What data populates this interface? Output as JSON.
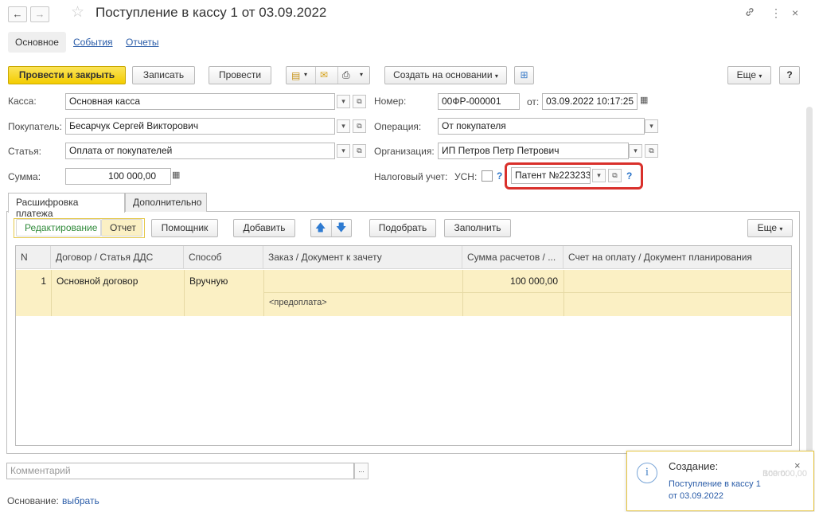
{
  "window": {
    "title": "Поступление в кассу 1 от 03.09.2022",
    "back": "←",
    "forward": "→",
    "star": "☆",
    "link": "🔗",
    "more": "⋮",
    "close": "×"
  },
  "top_tabs": [
    {
      "label": "Основное"
    },
    {
      "label": "События"
    },
    {
      "label": "Отчеты"
    }
  ],
  "toolbar": {
    "post_close": "Провести и закрыть",
    "save": "Записать",
    "post": "Провести",
    "create_based": "Создать на основании",
    "more": "Еще",
    "help": "?"
  },
  "form": {
    "kassa_label": "Касса:",
    "kassa_value": "Основная касса",
    "buyer_label": "Покупатель:",
    "buyer_value": "Бесарчук Сергей Викторович",
    "article_label": "Статья:",
    "article_value": "Оплата от покупателей",
    "sum_label": "Сумма:",
    "sum_value": "100 000,00",
    "number_label": "Номер:",
    "number_value": "00ФР-000001",
    "date_label": "от:",
    "date_value": "03.09.2022 10:17:25",
    "operation_label": "Операция:",
    "operation_value": "От покупателя",
    "org_label": "Организация:",
    "org_value": "ИП Петров Петр Петрович",
    "tax_label": "Налоговый учет:",
    "usn_label": "УСН:",
    "usn_q": "?",
    "patent_value": "Патент №223233:",
    "patent_q": "?"
  },
  "inner_tabs": [
    {
      "label": "Расшифровка платежа"
    },
    {
      "label": "Дополнительно"
    }
  ],
  "grid_toolbar": {
    "edit": "Редактирование",
    "report": "Отчет",
    "helper": "Помощник",
    "add": "Добавить",
    "pick": "Подобрать",
    "fill": "Заполнить",
    "more": "Еще"
  },
  "grid": {
    "columns": [
      "N",
      "Договор / Статья ДДС",
      "Способ",
      "Заказ / Документ к зачету",
      "Сумма расчетов / ...",
      "Счет на оплату / Документ планирования"
    ],
    "rows": [
      {
        "n": "1",
        "contract": "Основной договор",
        "method": "Вручную",
        "order": "",
        "prepay": "<предоплата>",
        "sum": "100 000,00",
        "invoice": ""
      }
    ]
  },
  "comment_placeholder": "Комментарий",
  "comment_btn": "...",
  "basis_label": "Основание:",
  "basis_link": "выбрать",
  "popup": {
    "title": "Создание:",
    "line1": "Поступление в кассу 1",
    "line2": "от 03.09.2022",
    "close": "×",
    "bg_total_label": "Всего:",
    "bg_total_value": "100 000,00"
  },
  "colors": {
    "primary_button": "#f3cc00",
    "row_highlight": "#fbf0c4",
    "annotation": "#d9302b",
    "link": "#2a5ca8"
  }
}
